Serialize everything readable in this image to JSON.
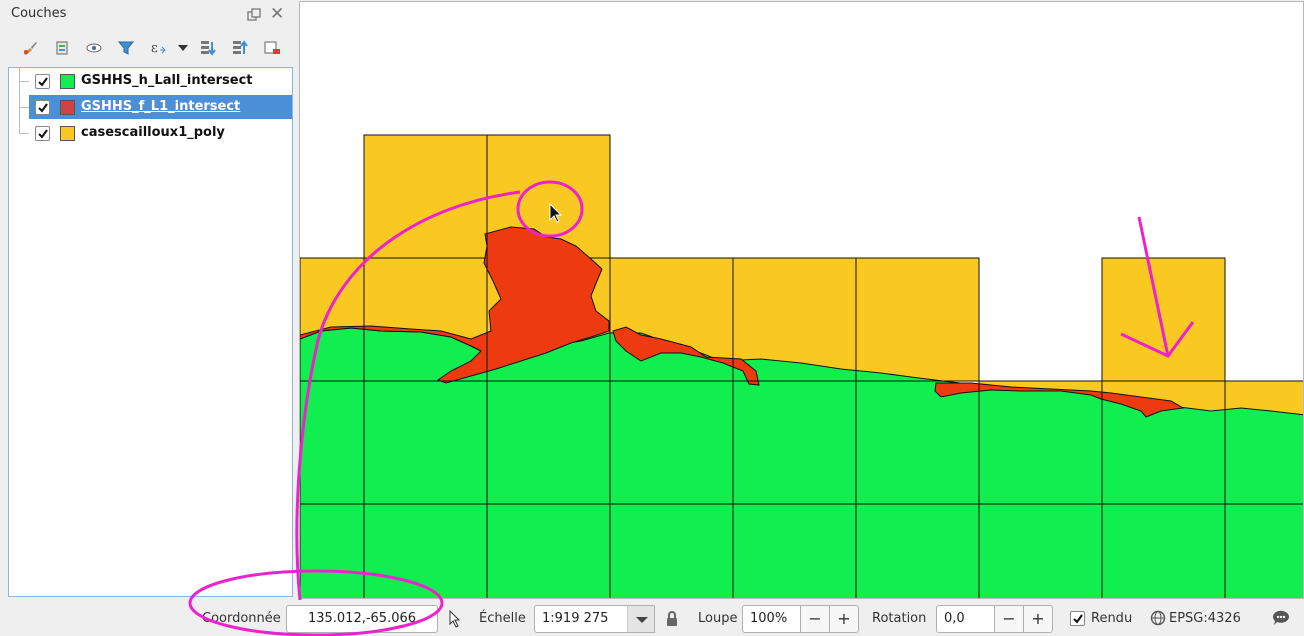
{
  "panel": {
    "title": "Couches",
    "layers": [
      {
        "name": "GSHHS_h_Lall_intersect",
        "color": "#10ee50",
        "checked": true,
        "selected": false
      },
      {
        "name": "GSHHS_f_L1_intersect",
        "color": "#cc4444",
        "checked": true,
        "selected": true
      },
      {
        "name": "casescailloux1_poly",
        "color": "#f9c922",
        "checked": true,
        "selected": false
      }
    ],
    "toolbar_icons": [
      "style-brush-icon",
      "add-group-icon",
      "eye-visibility-icon",
      "filter-icon",
      "expression-filter-icon",
      "dropdown-arrow-icon",
      "expand-all-icon",
      "collapse-all-icon",
      "remove-layer-icon"
    ]
  },
  "map": {
    "land_color": "#10ee50",
    "selected_layer_color": "#ee3a10",
    "grid_color": "#f9c922",
    "annotation_color": "#ee22cc"
  },
  "status": {
    "coord_label": "Coordonnée",
    "coord_value": "135.012,-65.066",
    "scale_label": "Échelle",
    "scale_value": "1:919 275",
    "zoom_label": "Loupe",
    "zoom_value": "100%",
    "rotation_label": "Rotation",
    "rotation_value": "0,0",
    "render_label": "Rendu",
    "render_checked": true,
    "crs_label": "EPSG:4326",
    "minus": "−",
    "plus": "+"
  }
}
